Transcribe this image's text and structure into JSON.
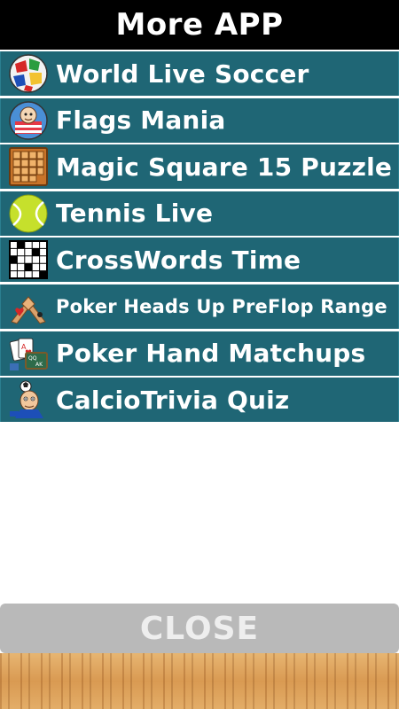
{
  "header": {
    "title": "More APP"
  },
  "apps": [
    {
      "label": "World Live Soccer",
      "icon": "soccer-flags-icon"
    },
    {
      "label": "Flags Mania",
      "icon": "flags-mania-icon"
    },
    {
      "label": "Magic Square 15 Puzzle",
      "icon": "puzzle-grid-icon"
    },
    {
      "label": "Tennis Live",
      "icon": "tennis-ball-icon"
    },
    {
      "label": "CrossWords Time",
      "icon": "crossword-grid-icon"
    },
    {
      "label": "Poker Heads Up PreFlop Range",
      "icon": "poker-hands-icon"
    },
    {
      "label": "Poker Hand Matchups",
      "icon": "poker-cards-icon"
    },
    {
      "label": "CalcioTrivia Quiz",
      "icon": "soccer-player-icon"
    }
  ],
  "close_button": {
    "label": "CLOSE"
  },
  "colors": {
    "header_bg": "#000000",
    "row_bg": "#1f6675",
    "close_bg": "#b9b9b9",
    "wood": "#dea35c"
  }
}
